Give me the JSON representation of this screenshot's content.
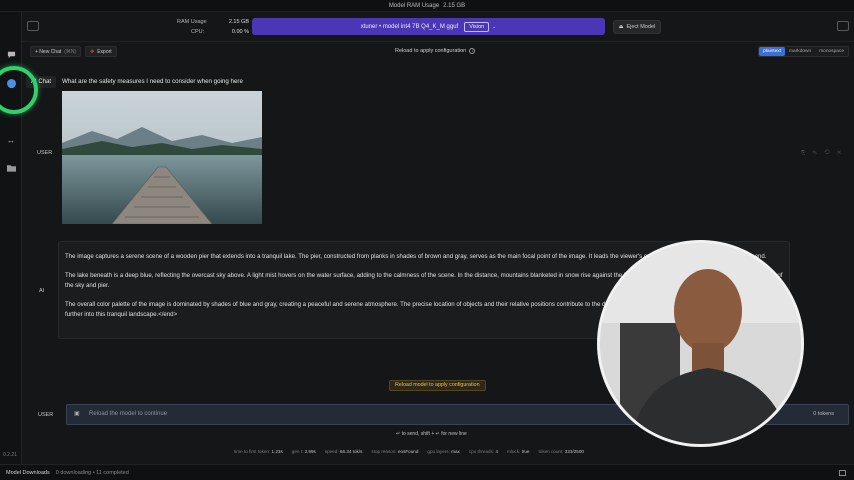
{
  "window": {
    "title_label": "Model RAM Usage",
    "title_value": "2.15 GB"
  },
  "header": {
    "ram_label": "RAM Usage",
    "ram_value": "2.15 GB",
    "cpu_label": "CPU:",
    "cpu_value": "0.00 %",
    "model_name": "xtuner • model int4 7B Q4_K_M gguf",
    "vision_badge": "Vision",
    "eject_label": "Eject Model"
  },
  "toolbar": {
    "new_chat_label": "+ New Chat",
    "new_chat_shortcut": "(⌘N)",
    "export_label": "Export",
    "reload_note": "Reload to apply configuration",
    "view_modes": [
      "plaintext",
      "markdown",
      "monospace"
    ],
    "active_view": "plaintext"
  },
  "chat": {
    "tooltip": "AI Chat",
    "user_role": "USER",
    "user_message": "What are the safety measures I need to consider when going here",
    "ai_role": "AI",
    "ai_paragraphs": [
      "The image captures a serene scene of a wooden pier that extends into a tranquil lake. The pier, constructed from planks in shades of brown and gray, serves as the main focal point of the image. It leads the viewer's eye towards a small island situated at its end.",
      "The lake beneath is a deep blue, reflecting the overcast sky above. A light mist hovers on the water surface, adding to the calmness of the scene. In the distance, mountains blanketed in snow rise against the horizon, their white peaks contrasting with the gray hues of the sky and pier.",
      "The overall color palette of the image is dominated by shades of blue and gray, creating a peaceful and serene atmosphere. The precise location of objects and their relative positions contribute to the depth and perspective of the image, drawing in viewers to explore further into this tranquil landscape.</end>"
    ],
    "reload_chip": "Reload model to apply configuration"
  },
  "input": {
    "role": "USER",
    "placeholder": "Reload the model to continue",
    "tokens": "0 tokens",
    "send_hint": "↵ to send, shift + ↵ for new line"
  },
  "stats": [
    {
      "label": "time to first token:",
      "value": "1.23s"
    },
    {
      "label": "gen t:",
      "value": "2.99s"
    },
    {
      "label": "speed:",
      "value": "66.34 tok/s"
    },
    {
      "label": "stop reason:",
      "value": "eosFound"
    },
    {
      "label": "gpu layers:",
      "value": "max"
    },
    {
      "label": "cpu threads:",
      "value": "4"
    },
    {
      "label": "mlock:",
      "value": "true"
    },
    {
      "label": "token count:",
      "value": "323/2500"
    }
  ],
  "footer": {
    "title": "Model Downloads",
    "status": "0 downloading • 11 completed"
  },
  "app_version": "0.2.21",
  "colors": {
    "accent": "#4b36b6",
    "active_tab": "#3b6fd8",
    "warning": "#e4c15b",
    "cursor_ring": "#2fd26a"
  }
}
